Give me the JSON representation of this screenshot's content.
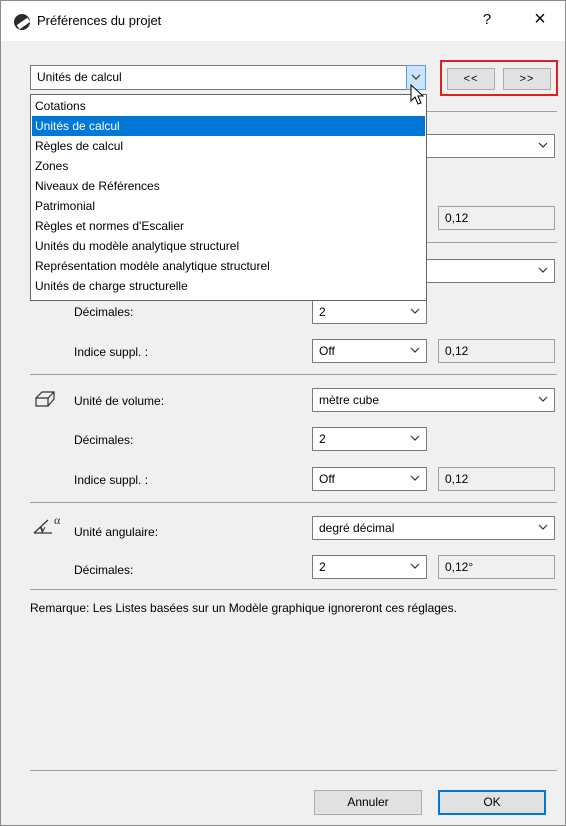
{
  "window": {
    "title": "Préférences du projet",
    "help_label": "?",
    "close_label": "×"
  },
  "category": {
    "selected": "Unités de calcul",
    "options": [
      "Cotations",
      "Unités de calcul",
      "Règles de calcul",
      "Zones",
      "Niveaux de Références",
      "Patrimonial",
      "Règles et normes d'Escalier",
      "Unités du modèle analytique structurel",
      "Représentation modèle analytique structurel",
      "Unités de charge structurelle"
    ],
    "highlighted_index": 1
  },
  "nav": {
    "prev_label": "<<",
    "next_label": ">>"
  },
  "partial": {
    "extra_value_1": "0,12"
  },
  "surface": {
    "decimals_label": "Décimales:",
    "decimals_value": "2",
    "extra_label": "Indice suppl. :",
    "extra_value": "Off",
    "preview": "0,12"
  },
  "volume": {
    "unit_label": "Unité de volume:",
    "unit_value": "mètre cube",
    "decimals_label": "Décimales:",
    "decimals_value": "2",
    "extra_label": "Indice suppl. :",
    "extra_value": "Off",
    "preview": "0,12"
  },
  "angle": {
    "unit_label": "Unité angulaire:",
    "unit_value": "degré décimal",
    "decimals_label": "Décimales:",
    "decimals_value": "2",
    "preview": "0,12°"
  },
  "note": "Remarque: Les Listes basées sur un Modèle graphique ignoreront ces réglages.",
  "buttons": {
    "cancel": "Annuler",
    "ok": "OK"
  }
}
